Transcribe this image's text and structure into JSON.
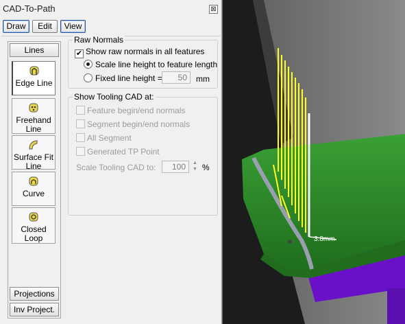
{
  "window": {
    "title": "CAD-To-Path",
    "close_glyph": "⊠"
  },
  "menu": {
    "draw": "Draw",
    "edit": "Edit",
    "view": "View"
  },
  "toolbar": {
    "lines": "Lines",
    "tools": [
      {
        "label": "Edge Line",
        "icon": "edge-line-icon"
      },
      {
        "label": "Freehand Line",
        "icon": "freehand-line-icon"
      },
      {
        "label": "Surface Fit Line",
        "icon": "surface-fit-line-icon"
      },
      {
        "label": "Curve",
        "icon": "curve-icon"
      },
      {
        "label": "Closed Loop",
        "icon": "closed-loop-icon"
      }
    ],
    "projections": "Projections",
    "inv_projections": "Inv Project."
  },
  "raw_normals": {
    "title": "Raw Normals",
    "show_label": "Show raw normals in all features",
    "show_checked": true,
    "scale_label": "Scale line height to feature length",
    "fixed_label": "Fixed line height =",
    "fixed_value": "50",
    "fixed_unit": "mm"
  },
  "tooling": {
    "title": "Show Tooling CAD at:",
    "feature": "Feature begin/end normals",
    "segment": "Segment begin/end normals",
    "all_segment": "All Segment",
    "generated": "Generated TP Point",
    "scale_label": "Scale Tooling CAD to:",
    "scale_value": "100",
    "scale_unit": "%"
  },
  "viewport": {
    "measure": "3.8mm"
  },
  "colors": {
    "tray_green": "#2f8a2a",
    "tray_edge": "#9a9fb0",
    "base_purple": "#6a10c8",
    "normals_yellow": "#ffff22",
    "highlight_white": "#ffffff"
  }
}
